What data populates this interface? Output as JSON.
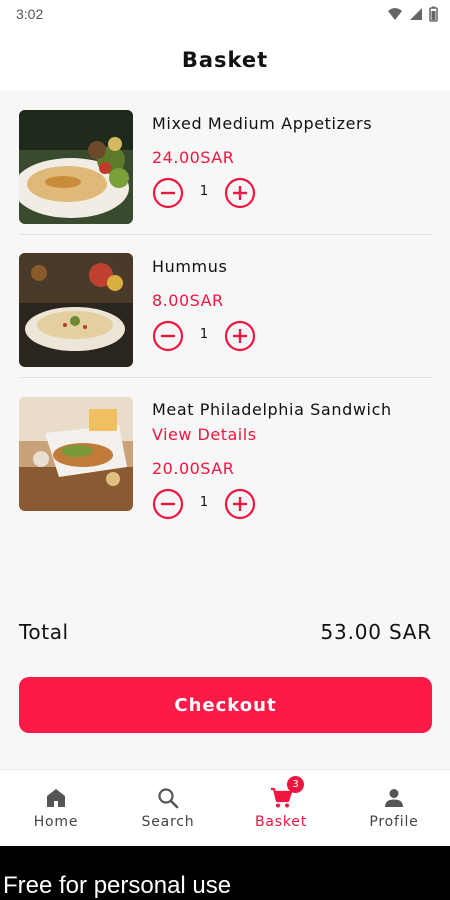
{
  "status_bar": {
    "time": "3:02"
  },
  "header": {
    "title": "Basket"
  },
  "items": [
    {
      "name": "Mixed Medium Appetizers",
      "price": "24.00SAR",
      "quantity": "1",
      "image": "food-photo-appetizers"
    },
    {
      "name": "Hummus",
      "price": "8.00SAR",
      "quantity": "1",
      "image": "food-photo-hummus"
    },
    {
      "name": "Meat Philadelphia Sandwich",
      "details_link": "View Details",
      "price": "20.00SAR",
      "quantity": "1",
      "image": "food-photo-sandwich"
    }
  ],
  "total": {
    "label": "Total",
    "value": "53.00 SAR"
  },
  "checkout": {
    "label": "Checkout"
  },
  "nav": {
    "items": [
      {
        "label": "Home",
        "icon": "home-icon"
      },
      {
        "label": "Search",
        "icon": "search-icon"
      },
      {
        "label": "Basket",
        "icon": "cart-icon",
        "badge": "3",
        "active": true
      },
      {
        "label": "Profile",
        "icon": "person-icon"
      }
    ]
  },
  "watermark": "Free for personal use",
  "colors": {
    "accent": "#fe1a47",
    "text": "#111111",
    "background": "#f7f7f7"
  }
}
